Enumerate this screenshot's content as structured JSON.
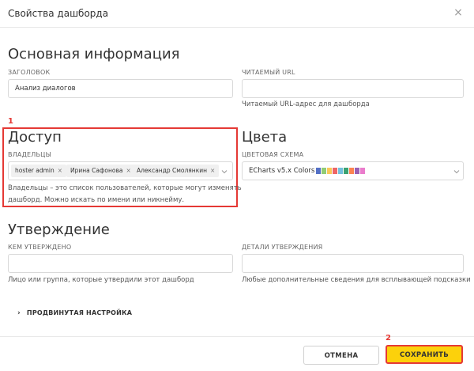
{
  "header": {
    "title": "Свойства дашборда",
    "close_glyph": "×"
  },
  "basic": {
    "title": "Основная информация",
    "heading_label": "ЗАГОЛОВОК",
    "heading_value": "Анализ диалогов",
    "url_label": "ЧИТАЕМЫЙ URL",
    "url_value": "",
    "url_helper": "Читаемый URL-адрес для дашборда"
  },
  "access": {
    "step": "1",
    "title": "Доступ",
    "owners_label": "ВЛАДЕЛЬЦЫ",
    "owners": [
      "hoster admin",
      "Ирина Сафонова",
      "Александр Смолянкин"
    ],
    "helper_line1": "Владельцы – это список пользователей, которые могут изменять",
    "helper_line2": "дашборд. Можно искать по имени или никнейму."
  },
  "colors": {
    "title": "Цвета",
    "scheme_label": "ЦВЕТОВАЯ СХЕМА",
    "scheme_value": "ECharts v5.x Colors",
    "palette": [
      "#5470c6",
      "#91cc75",
      "#fac858",
      "#ee6666",
      "#73c0de",
      "#3ba272",
      "#fc8452",
      "#9a60b4",
      "#ea7ccc"
    ]
  },
  "approval": {
    "title": "Утверждение",
    "by_label": "КЕМ УТВЕРЖДЕНО",
    "by_value": "",
    "by_helper": "Лицо или группа, которые утвердили этот дашборд",
    "details_label": "ДЕТАЛИ УТВЕРЖДЕНИЯ",
    "details_value": "",
    "details_helper": "Любые дополнительные сведения для всплывающей подсказки"
  },
  "advanced": {
    "label": "ПРОДВИНУТАЯ НАСТРОЙКА",
    "arrow": "›"
  },
  "footer": {
    "step": "2",
    "cancel": "ОТМЕНА",
    "save": "СОХРАНИТЬ"
  },
  "colors_ui": {
    "accent_yellow": "#fcd10b",
    "highlight_red": "#e53935"
  }
}
